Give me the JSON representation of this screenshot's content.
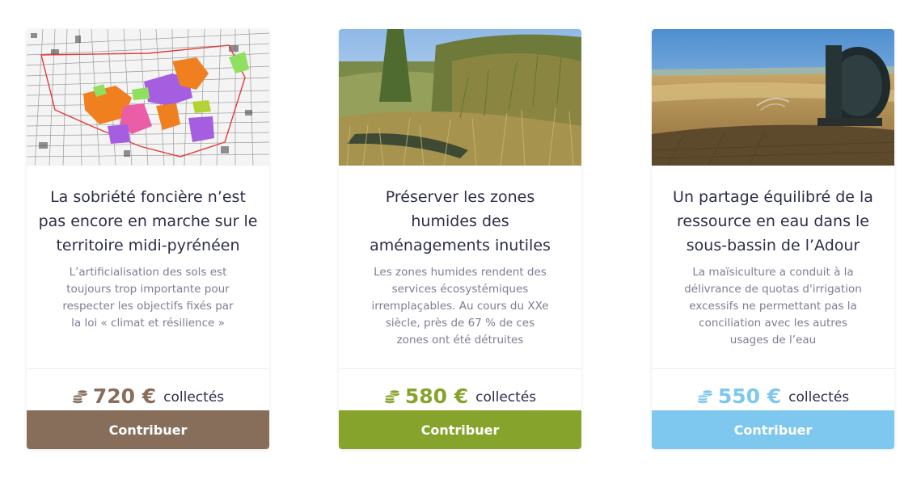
{
  "cards": [
    {
      "image_alt": "plan cadastral",
      "title": "La sobriété foncière n’est pas encore en marche sur le territoire midi-pyrénéen",
      "description": "L’artificialisation des sols est toujours trop importante pour respecter les objectifs fixés par la loi « climat et résilience »",
      "amount": "720 €",
      "collected_label": "collectés",
      "button_label": "Contribuer",
      "accent_color": "#866e5a",
      "icon": "coins-icon"
    },
    {
      "image_alt": "zone humide",
      "title": "Préserver les zones humides des aménagements inutiles",
      "description": "Les zones humides rendent des services écosystémiques irremplaçables. Au cours du XXe siècle, près de 67 % de ces zones ont été détruites",
      "amount": "580 €",
      "collected_label": "collectés",
      "button_label": "Contribuer",
      "accent_color": "#86a42c",
      "icon": "coins-icon"
    },
    {
      "image_alt": "irrigation",
      "title": "Un partage équilibré de la ressource en eau dans le sous-bassin de l’Adour",
      "description": "La maïsiculture a conduit à la délivrance de quotas d'irrigation excessifs ne permettant pas la conciliation avec les autres usages de l’eau",
      "amount": "550 €",
      "collected_label": "collectés",
      "button_label": "Contribuer",
      "accent_color": "#7ec7ef",
      "icon": "coins-icon"
    }
  ]
}
